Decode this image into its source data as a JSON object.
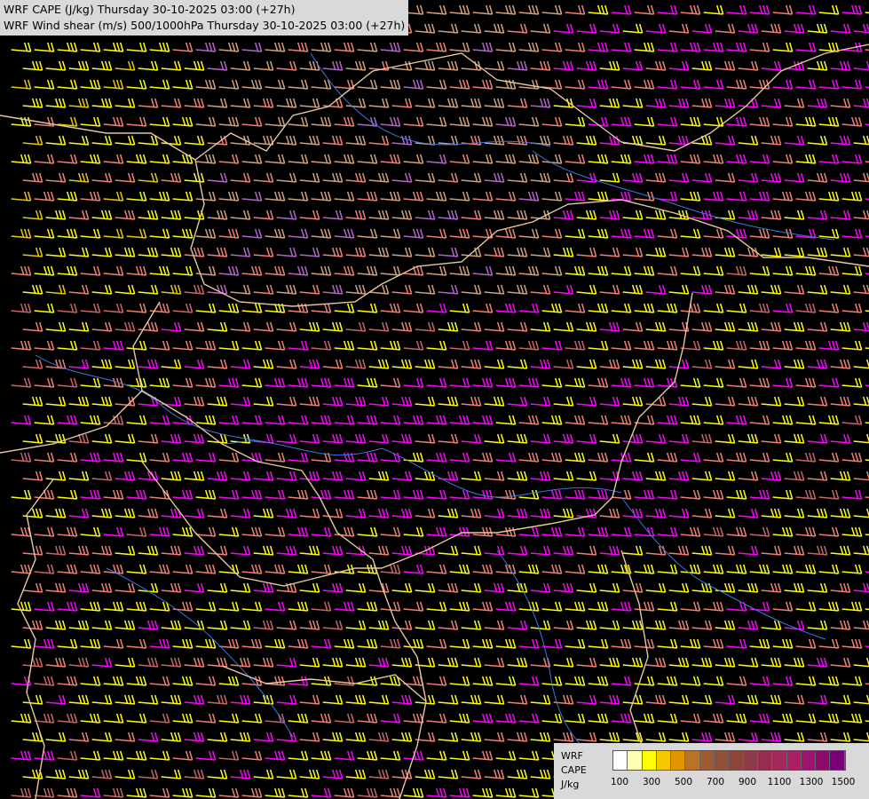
{
  "titles": {
    "line1": "WRF CAPE (J/kg) Thursday 30-10-2025 03:00 (+27h)",
    "line2": "WRF Wind shear (m/s) 500/1000hPa Thursday 30-10-2025 03:00 (+27h)"
  },
  "legend": {
    "model_label": "WRF",
    "field_label": "CAPE",
    "unit_label": "J/kg",
    "colors": [
      "#ffffff",
      "#ffffb4",
      "#ffff00",
      "#f5c800",
      "#e19600",
      "#b97328",
      "#a05a32",
      "#915037",
      "#8c463c",
      "#8c3c46",
      "#962d50",
      "#a0285a",
      "#aa1e64",
      "#9b146e",
      "#8c0a6e",
      "#780078"
    ],
    "tick_labels": [
      "100",
      "300",
      "500",
      "700",
      "900",
      "1100",
      "1300",
      "1500"
    ]
  },
  "map": {
    "background": "#000000",
    "barb_colors": [
      "#ffff00",
      "#e6c800",
      "#f08070",
      "#d2a078",
      "#ff00ff",
      "#c86464",
      "#dc00dc",
      "#b464c8"
    ],
    "border_color": "#e6c8a0",
    "river_color": "#3c78dc"
  }
}
